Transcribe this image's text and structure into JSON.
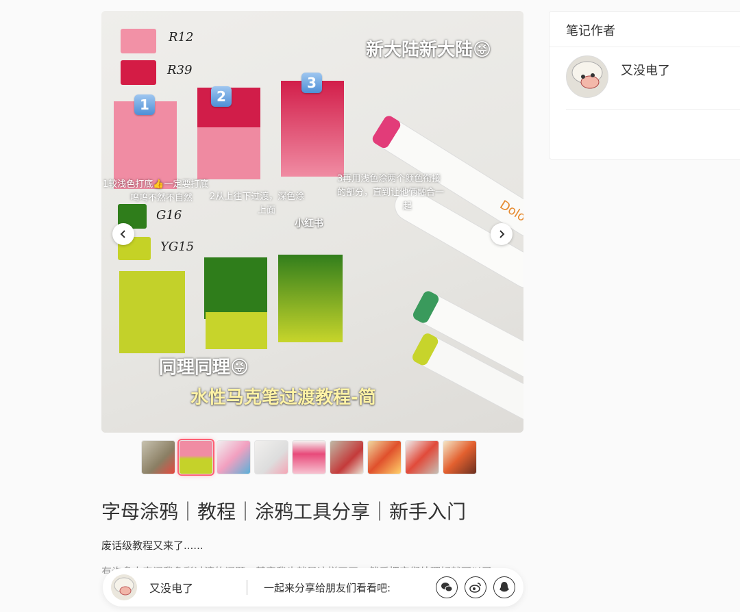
{
  "hero": {
    "overlay_title": "新大陆新大陆😜",
    "overlay_bottom1": "同理同理😜",
    "overlay_bottom2": "水性马克笔过渡教程-简",
    "swatch_labels": [
      "R12",
      "R39",
      "G16",
      "YG15"
    ],
    "steps": [
      "1",
      "2",
      "3"
    ],
    "note1_line1": "1较浅色打底👍一定要打底",
    "note1_line2": "呜呜不然不自然",
    "note2_line1": "2从上往下过渡，深色涂",
    "note2_line2": "上面",
    "note3_line1": "3再用浅色涂两个颜色衔接",
    "note3_line2": "的部分，直到让他俩融合一",
    "note3_line3": "起",
    "watermark": "小红书",
    "pen_brand": "Dolo"
  },
  "nav": {
    "prev_icon": "chevron-left-icon",
    "next_icon": "chevron-right-icon"
  },
  "thumbnails": {
    "count": 9,
    "active_index": 1
  },
  "note": {
    "title": "字母涂鸦｜教程｜涂鸦工具分享｜新手入门",
    "desc_line1": "废话级教程又来了......",
    "desc_line2_partial": "有许多人来问我色彩过渡的问题，其实我也就是这样画画，然后把它们处理好就可以了"
  },
  "sharebar": {
    "author_name": "又没电了",
    "share_text": "一起来分享给朋友们看看吧:",
    "buttons": [
      "wechat-icon",
      "weibo-icon",
      "qq-icon"
    ]
  },
  "author_card": {
    "header": "笔记作者",
    "name": "又没电了"
  },
  "colors": {
    "accent": "#ff5f74",
    "pink_light": "#f28aa0",
    "pink_dark": "#d81e4a",
    "green_dark": "#3e8a1e",
    "yellow_green": "#c6d52a"
  }
}
